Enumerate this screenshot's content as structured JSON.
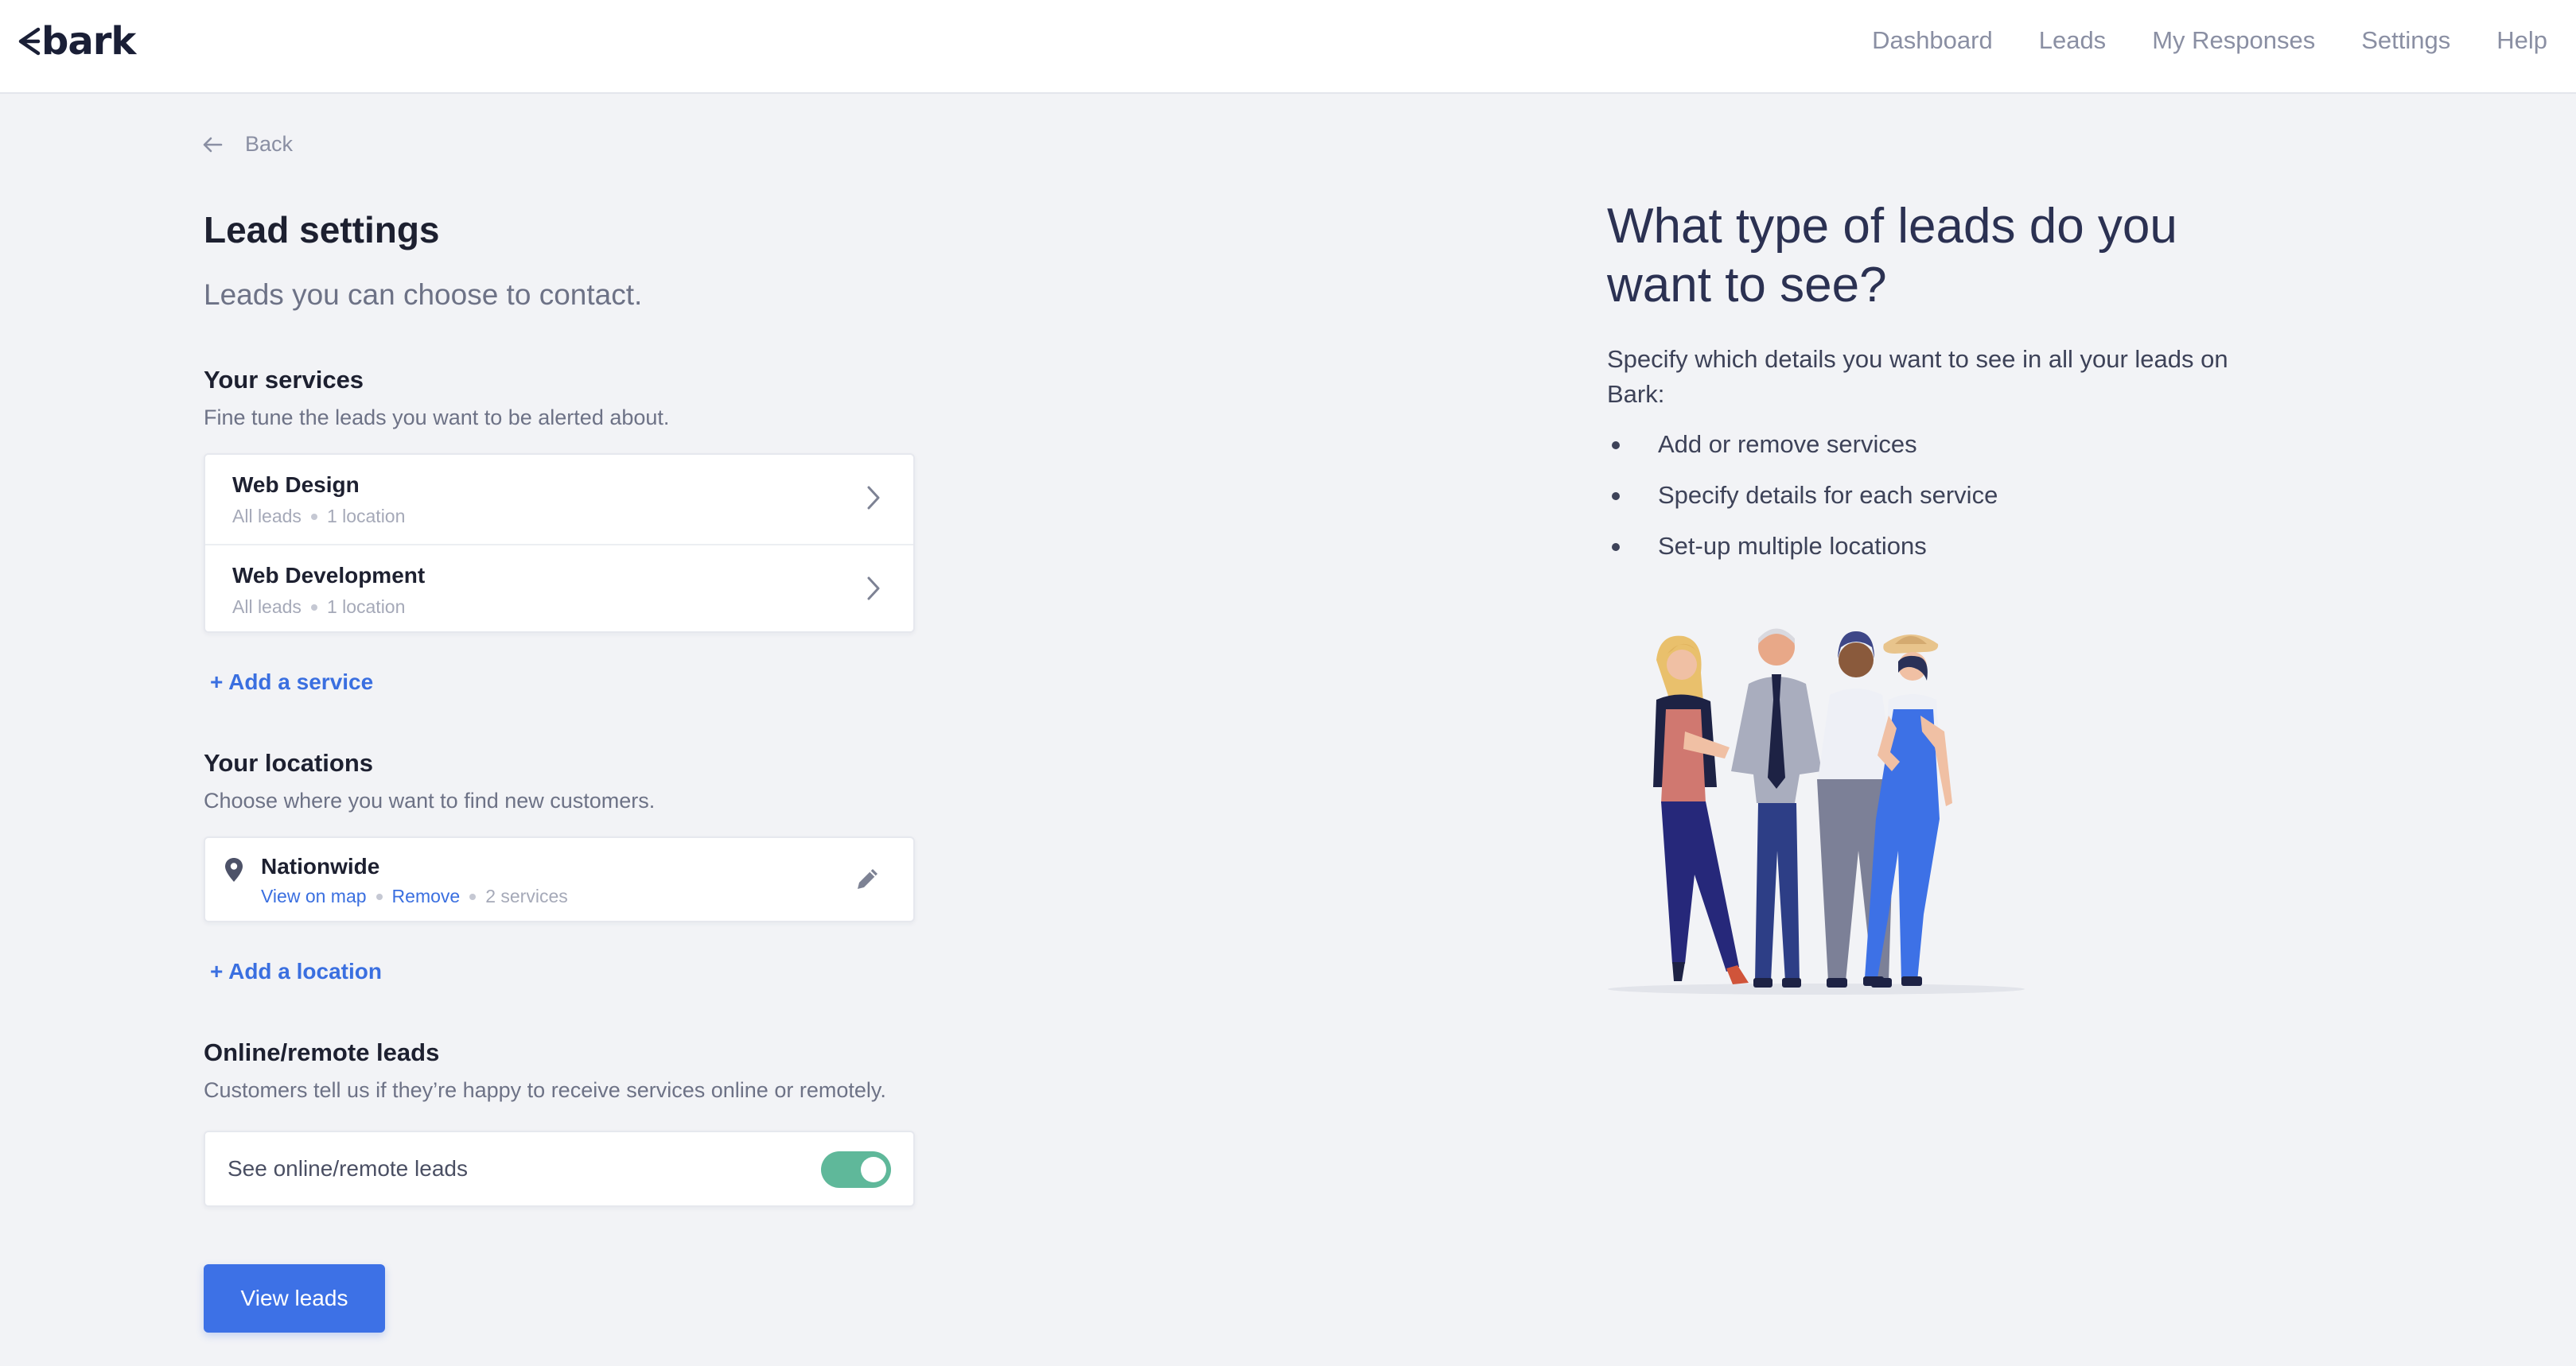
{
  "header": {
    "logo": "bark",
    "nav": [
      "Dashboard",
      "Leads",
      "My Responses",
      "Settings",
      "Help"
    ]
  },
  "back_label": "Back",
  "page": {
    "title": "Lead settings",
    "subtitle": "Leads you can choose to contact."
  },
  "services": {
    "title": "Your services",
    "description": "Fine tune the leads you want to be alerted about.",
    "items": [
      {
        "name": "Web Design",
        "leads": "All leads",
        "locations": "1 location"
      },
      {
        "name": "Web Development",
        "leads": "All leads",
        "locations": "1 location"
      }
    ],
    "add_label": "+ Add a service"
  },
  "locations": {
    "title": "Your locations",
    "description": "Choose where you want to find new customers.",
    "items": [
      {
        "name": "Nationwide",
        "view_label": "View on map",
        "remove_label": "Remove",
        "services": "2 services"
      }
    ],
    "add_label": "+ Add a location"
  },
  "online": {
    "title": "Online/remote leads",
    "description": "Customers tell us if they’re happy to receive services online or remotely.",
    "toggle_label": "See online/remote leads",
    "toggle_on": true
  },
  "view_leads_label": "View leads",
  "promo": {
    "title": "What type of leads do you want to see?",
    "description": "Specify which details you want to see in all your leads on Bark:",
    "bullets": [
      "Add or remove services",
      "Specify details for each service",
      "Set-up multiple locations"
    ]
  },
  "colors": {
    "accent": "#3d71e6",
    "toggle": "#5fb89a",
    "background": "#f2f3f6"
  }
}
